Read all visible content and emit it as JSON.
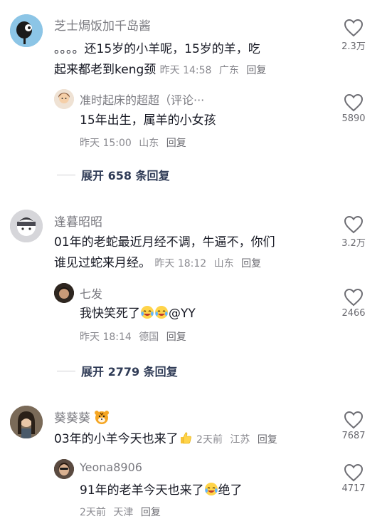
{
  "comments": [
    {
      "user": "芝士焗饭加千岛酱",
      "text_line1": "。。。。还15岁的小羊呢，15岁的羊，吃",
      "text_line2": "起来都老到keng颈",
      "time": "昨天 14:58",
      "location": "广东",
      "reply_label": "回复",
      "likes": "2.3万",
      "reply": {
        "user": "准时起床的超超（评论···",
        "text": "15年出生，属羊的小女孩",
        "time": "昨天 15:00",
        "location": "山东",
        "reply_label": "回复",
        "likes": "5890"
      },
      "expand": "展开 658 条回复"
    },
    {
      "user": "逢暮昭昭",
      "text_line1": "01年的老蛇最近月经不调，牛逼不，你们",
      "text_line2": "谁见过蛇来月经。",
      "time": "昨天 18:12",
      "location": "山东",
      "reply_label": "回复",
      "likes": "3.2万",
      "reply": {
        "user": "七发",
        "text_before": "我快笑死了",
        "text_after": "@YY",
        "time": "昨天 18:14",
        "location": "德国",
        "reply_label": "回复",
        "likes": "2466"
      },
      "expand": "展开 2779 条回复"
    },
    {
      "user": "葵葵葵",
      "text": "03年的小羊今天也来了",
      "time": "2天前",
      "location": "江苏",
      "reply_label": "回复",
      "likes": "7687",
      "reply": {
        "user": "Yeona8906",
        "text_before": "91年的老羊今天也来了",
        "text_after": "绝了",
        "time": "2天前",
        "location": "天津",
        "reply_label": "回复",
        "likes": "4717"
      }
    }
  ],
  "icons": {
    "like": "heart-outline-icon",
    "laugh_cry": "laugh-cry-emoji",
    "tiger": "tiger-emoji",
    "thumbs_up": "thumbs-up-emoji"
  },
  "colors": {
    "background": "#ffffff",
    "text": "#161823",
    "secondary": "#8a8a90",
    "expand": "#2f3b56"
  }
}
